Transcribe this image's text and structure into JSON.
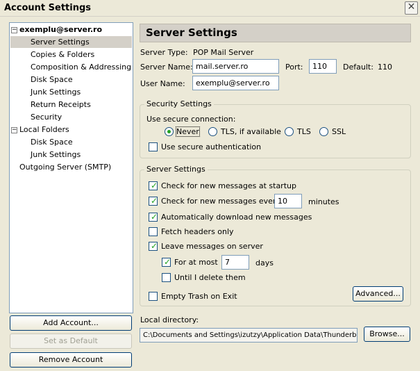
{
  "window": {
    "title": "Account Settings"
  },
  "tree": {
    "account": "exemplu@server.ro",
    "account_items": [
      "Server Settings",
      "Copies & Folders",
      "Composition & Addressing",
      "Disk Space",
      "Junk Settings",
      "Return Receipts",
      "Security"
    ],
    "local_folders": "Local Folders",
    "local_items": [
      "Disk Space",
      "Junk Settings"
    ],
    "outgoing": "Outgoing Server (SMTP)"
  },
  "buttons": {
    "add_account": "Add Account...",
    "set_default": "Set as Default",
    "remove_account": "Remove Account",
    "advanced": "Advanced...",
    "browse": "Browse..."
  },
  "server": {
    "heading": "Server Settings",
    "type_label": "Server Type:",
    "type_value": "POP Mail Server",
    "name_label": "Server Name:",
    "name_value": "mail.server.ro",
    "port_label": "Port:",
    "port_value": "110",
    "default_label": "Default:",
    "default_value": "110",
    "user_label": "User Name:",
    "user_value": "exemplu@server.ro"
  },
  "security": {
    "group_title": "Security Settings",
    "secure_label": "Use secure connection:",
    "options": [
      "Never",
      "TLS, if available",
      "TLS",
      "SSL"
    ],
    "selected": "Never",
    "secure_auth": "Use secure authentication"
  },
  "server_settings": {
    "group_title": "Server Settings",
    "check_startup": "Check for new messages at startup",
    "check_every": "Check for new messages every",
    "check_every_value": "10",
    "minutes": "minutes",
    "auto_download": "Automatically download new messages",
    "fetch_headers": "Fetch headers only",
    "leave_on_server": "Leave messages on server",
    "for_at_most": "For at most",
    "for_at_most_value": "7",
    "days": "days",
    "until_delete": "Until I delete them",
    "empty_trash": "Empty Trash on Exit"
  },
  "local_dir": {
    "label": "Local directory:",
    "value": "C:\\Documents and Settings\\izutzy\\Application Data\\Thunderbird"
  },
  "colors": {
    "check": "#21a121",
    "selection": "#d4d0c8",
    "border": "#7f9db9"
  }
}
